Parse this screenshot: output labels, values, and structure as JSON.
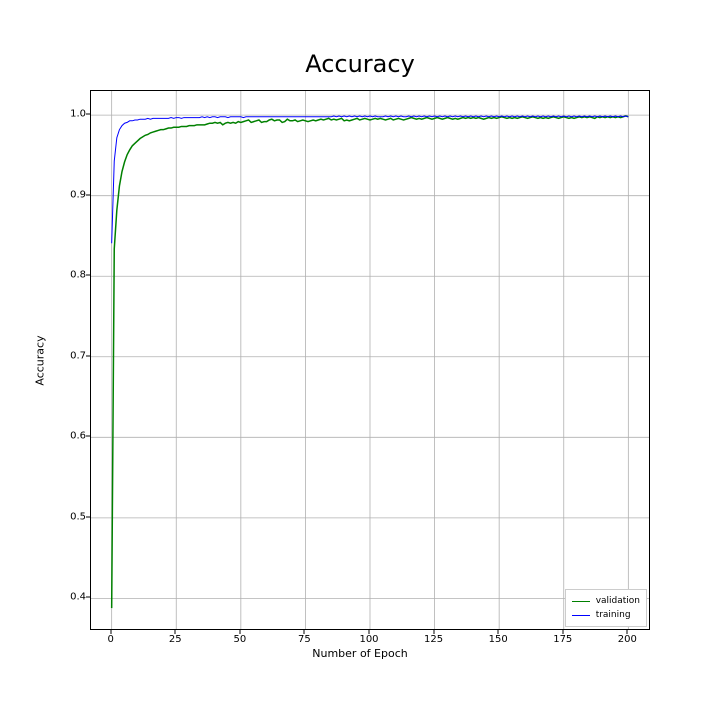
{
  "chart_data": {
    "type": "line",
    "title": "Accuracy",
    "xlabel": "Number of Epoch",
    "ylabel": "Accuracy",
    "xlim": [
      -8,
      208
    ],
    "ylim": [
      0.362,
      1.03
    ],
    "xticks": [
      0,
      25,
      50,
      75,
      100,
      125,
      150,
      175,
      200
    ],
    "yticks": [
      0.4,
      0.5,
      0.6,
      0.7,
      0.8,
      0.9,
      1.0
    ],
    "legend_position": "lower right",
    "series": [
      {
        "name": "validation",
        "color": "#008000",
        "x": [
          0,
          1,
          2,
          3,
          4,
          5,
          6,
          7,
          8,
          9,
          10,
          11,
          12,
          13,
          14,
          15,
          16,
          17,
          18,
          19,
          20,
          21,
          22,
          23,
          24,
          25,
          26,
          27,
          28,
          29,
          30,
          31,
          32,
          33,
          34,
          35,
          36,
          37,
          38,
          39,
          40,
          41,
          42,
          43,
          44,
          45,
          46,
          47,
          48,
          49,
          50,
          51,
          52,
          53,
          54,
          55,
          56,
          57,
          58,
          59,
          60,
          61,
          62,
          63,
          64,
          65,
          66,
          67,
          68,
          69,
          70,
          71,
          72,
          73,
          74,
          75,
          76,
          77,
          78,
          79,
          80,
          81,
          82,
          83,
          84,
          85,
          86,
          87,
          88,
          89,
          90,
          91,
          92,
          93,
          94,
          95,
          96,
          97,
          98,
          99,
          100,
          101,
          102,
          103,
          104,
          105,
          106,
          107,
          108,
          109,
          110,
          111,
          112,
          113,
          114,
          115,
          116,
          117,
          118,
          119,
          120,
          121,
          122,
          123,
          124,
          125,
          126,
          127,
          128,
          129,
          130,
          131,
          132,
          133,
          134,
          135,
          136,
          137,
          138,
          139,
          140,
          141,
          142,
          143,
          144,
          145,
          146,
          147,
          148,
          149,
          150,
          151,
          152,
          153,
          154,
          155,
          156,
          157,
          158,
          159,
          160,
          161,
          162,
          163,
          164,
          165,
          166,
          167,
          168,
          169,
          170,
          171,
          172,
          173,
          174,
          175,
          176,
          177,
          178,
          179,
          180,
          181,
          182,
          183,
          184,
          185,
          186,
          187,
          188,
          189,
          190,
          191,
          192,
          193,
          194,
          195,
          196,
          197,
          198,
          199,
          200
        ],
        "values": [
          0.388,
          0.834,
          0.882,
          0.912,
          0.93,
          0.942,
          0.951,
          0.957,
          0.962,
          0.965,
          0.968,
          0.971,
          0.973,
          0.975,
          0.976,
          0.978,
          0.979,
          0.98,
          0.981,
          0.982,
          0.982,
          0.983,
          0.984,
          0.984,
          0.985,
          0.985,
          0.985,
          0.986,
          0.986,
          0.986,
          0.987,
          0.987,
          0.987,
          0.988,
          0.988,
          0.988,
          0.988,
          0.989,
          0.99,
          0.99,
          0.991,
          0.99,
          0.991,
          0.988,
          0.99,
          0.991,
          0.99,
          0.991,
          0.99,
          0.992,
          0.991,
          0.992,
          0.993,
          0.994,
          0.991,
          0.992,
          0.993,
          0.994,
          0.991,
          0.992,
          0.992,
          0.994,
          0.995,
          0.993,
          0.994,
          0.994,
          0.991,
          0.992,
          0.995,
          0.993,
          0.993,
          0.994,
          0.992,
          0.993,
          0.994,
          0.993,
          0.992,
          0.993,
          0.994,
          0.993,
          0.994,
          0.995,
          0.994,
          0.995,
          0.996,
          0.994,
          0.995,
          0.994,
          0.995,
          0.996,
          0.993,
          0.994,
          0.993,
          0.994,
          0.995,
          0.996,
          0.994,
          0.995,
          0.996,
          0.995,
          0.994,
          0.995,
          0.996,
          0.995,
          0.996,
          0.995,
          0.994,
          0.995,
          0.996,
          0.994,
          0.995,
          0.996,
          0.995,
          0.994,
          0.995,
          0.996,
          0.997,
          0.996,
          0.995,
          0.996,
          0.995,
          0.996,
          0.997,
          0.996,
          0.995,
          0.996,
          0.997,
          0.996,
          0.995,
          0.996,
          0.997,
          0.996,
          0.995,
          0.996,
          0.995,
          0.996,
          0.997,
          0.996,
          0.997,
          0.996,
          0.997,
          0.996,
          0.997,
          0.996,
          0.995,
          0.996,
          0.997,
          0.996,
          0.997,
          0.996,
          0.997,
          0.998,
          0.997,
          0.996,
          0.997,
          0.996,
          0.997,
          0.996,
          0.997,
          0.998,
          0.997,
          0.996,
          0.997,
          0.998,
          0.997,
          0.996,
          0.997,
          0.996,
          0.997,
          0.996,
          0.997,
          0.998,
          0.997,
          0.996,
          0.997,
          0.998,
          0.997,
          0.996,
          0.997,
          0.996,
          0.997,
          0.998,
          0.997,
          0.998,
          0.997,
          0.998,
          0.997,
          0.996,
          0.998,
          0.997,
          0.998,
          0.997,
          0.998,
          0.997,
          0.998,
          0.997,
          0.998,
          0.997,
          0.998,
          0.999,
          0.998
        ]
      },
      {
        "name": "training",
        "color": "#0000ff",
        "x": [
          0,
          1,
          2,
          3,
          4,
          5,
          6,
          7,
          8,
          9,
          10,
          11,
          12,
          13,
          14,
          15,
          16,
          17,
          18,
          19,
          20,
          21,
          22,
          23,
          24,
          25,
          26,
          27,
          28,
          29,
          30,
          31,
          32,
          33,
          34,
          35,
          36,
          37,
          38,
          39,
          40,
          41,
          42,
          43,
          44,
          45,
          46,
          47,
          48,
          49,
          50,
          51,
          52,
          53,
          54,
          55,
          56,
          57,
          58,
          59,
          60,
          61,
          62,
          63,
          64,
          65,
          66,
          67,
          68,
          69,
          70,
          71,
          72,
          73,
          74,
          75,
          76,
          77,
          78,
          79,
          80,
          81,
          82,
          83,
          84,
          85,
          86,
          87,
          88,
          89,
          90,
          91,
          92,
          93,
          94,
          95,
          96,
          97,
          98,
          99,
          100,
          101,
          102,
          103,
          104,
          105,
          106,
          107,
          108,
          109,
          110,
          111,
          112,
          113,
          114,
          115,
          116,
          117,
          118,
          119,
          120,
          121,
          122,
          123,
          124,
          125,
          126,
          127,
          128,
          129,
          130,
          131,
          132,
          133,
          134,
          135,
          136,
          137,
          138,
          139,
          140,
          141,
          142,
          143,
          144,
          145,
          146,
          147,
          148,
          149,
          150,
          151,
          152,
          153,
          154,
          155,
          156,
          157,
          158,
          159,
          160,
          161,
          162,
          163,
          164,
          165,
          166,
          167,
          168,
          169,
          170,
          171,
          172,
          173,
          174,
          175,
          176,
          177,
          178,
          179,
          180,
          181,
          182,
          183,
          184,
          185,
          186,
          187,
          188,
          189,
          190,
          191,
          192,
          193,
          194,
          195,
          196,
          197,
          198,
          199,
          200
        ],
        "values": [
          0.841,
          0.943,
          0.972,
          0.982,
          0.987,
          0.99,
          0.991,
          0.993,
          0.993,
          0.994,
          0.994,
          0.995,
          0.995,
          0.995,
          0.996,
          0.995,
          0.996,
          0.996,
          0.996,
          0.996,
          0.996,
          0.996,
          0.996,
          0.997,
          0.996,
          0.997,
          0.997,
          0.996,
          0.997,
          0.997,
          0.997,
          0.997,
          0.997,
          0.997,
          0.997,
          0.998,
          0.997,
          0.998,
          0.997,
          0.998,
          0.998,
          0.997,
          0.998,
          0.998,
          0.998,
          0.997,
          0.998,
          0.998,
          0.998,
          0.998,
          0.998,
          0.997,
          0.998,
          0.998,
          0.998,
          0.998,
          0.998,
          0.998,
          0.998,
          0.998,
          0.998,
          0.998,
          0.998,
          0.998,
          0.998,
          0.998,
          0.998,
          0.998,
          0.998,
          0.998,
          0.998,
          0.998,
          0.998,
          0.998,
          0.998,
          0.998,
          0.998,
          0.998,
          0.998,
          0.998,
          0.998,
          0.998,
          0.998,
          0.998,
          0.998,
          0.998,
          0.999,
          0.998,
          0.999,
          0.998,
          0.999,
          0.998,
          0.999,
          0.998,
          0.999,
          0.998,
          0.999,
          0.998,
          0.999,
          0.998,
          0.999,
          0.998,
          0.999,
          0.998,
          0.998,
          0.998,
          0.999,
          0.998,
          0.999,
          0.998,
          0.999,
          0.998,
          0.999,
          0.998,
          0.998,
          0.999,
          0.998,
          0.999,
          0.998,
          0.999,
          0.998,
          0.999,
          0.998,
          0.999,
          0.998,
          0.999,
          0.998,
          0.999,
          0.998,
          0.999,
          0.998,
          0.999,
          0.998,
          0.999,
          0.998,
          0.999,
          0.998,
          0.999,
          0.998,
          0.999,
          0.998,
          0.999,
          0.998,
          0.999,
          0.998,
          0.999,
          0.998,
          0.999,
          0.998,
          0.999,
          0.998,
          0.999,
          0.998,
          0.999,
          0.998,
          0.999,
          0.998,
          0.999,
          0.998,
          0.999,
          0.998,
          0.999,
          0.998,
          0.999,
          0.998,
          0.999,
          0.998,
          0.999,
          0.998,
          0.999,
          0.998,
          0.999,
          0.998,
          0.999,
          0.998,
          0.999,
          0.998,
          0.999,
          0.998,
          0.999,
          0.998,
          0.999,
          0.998,
          0.999,
          0.998,
          0.999,
          0.998,
          0.999,
          0.998,
          0.999,
          0.998,
          0.999,
          0.998,
          0.999,
          0.998,
          0.999,
          0.998,
          0.999,
          0.998,
          0.999,
          0.998
        ]
      }
    ]
  }
}
